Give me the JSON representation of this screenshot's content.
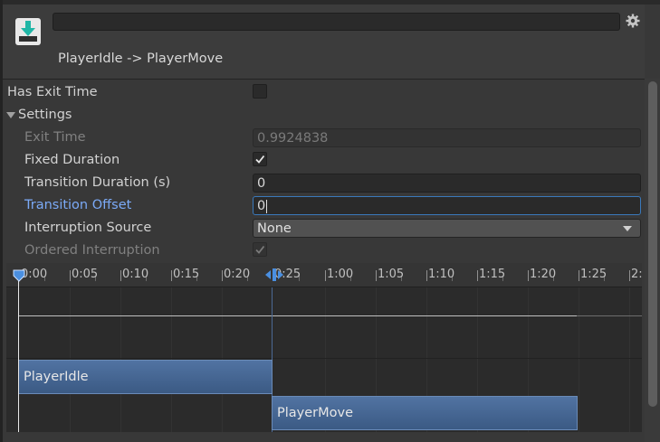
{
  "header": {
    "title": "PlayerIdle -> PlayerMove",
    "name_value": ""
  },
  "properties": {
    "has_exit_time": {
      "label": "Has Exit Time",
      "checked": false
    },
    "settings": {
      "label": "Settings"
    },
    "exit_time": {
      "label": "Exit Time",
      "value": "0.9924838"
    },
    "fixed_duration": {
      "label": "Fixed Duration",
      "checked": true
    },
    "transition_duration": {
      "label": "Transition Duration (s)",
      "value": "0"
    },
    "transition_offset": {
      "label": "Transition Offset",
      "value": "0"
    },
    "interruption_source": {
      "label": "Interruption Source",
      "value": "None"
    },
    "ordered_interruption": {
      "label": "Ordered Interruption",
      "checked": true
    }
  },
  "timeline": {
    "ticks": [
      "0:00",
      "0:05",
      "0:10",
      "0:15",
      "0:20",
      "0:25",
      "1:00",
      "1:05",
      "1:10",
      "1:15",
      "1:20",
      "1:25",
      "2:"
    ],
    "clips": {
      "source": "PlayerIdle",
      "destination": "PlayerMove"
    }
  },
  "colors": {
    "accent": "#7baaf7",
    "clip": "#4a6a96",
    "background": "#383838"
  }
}
